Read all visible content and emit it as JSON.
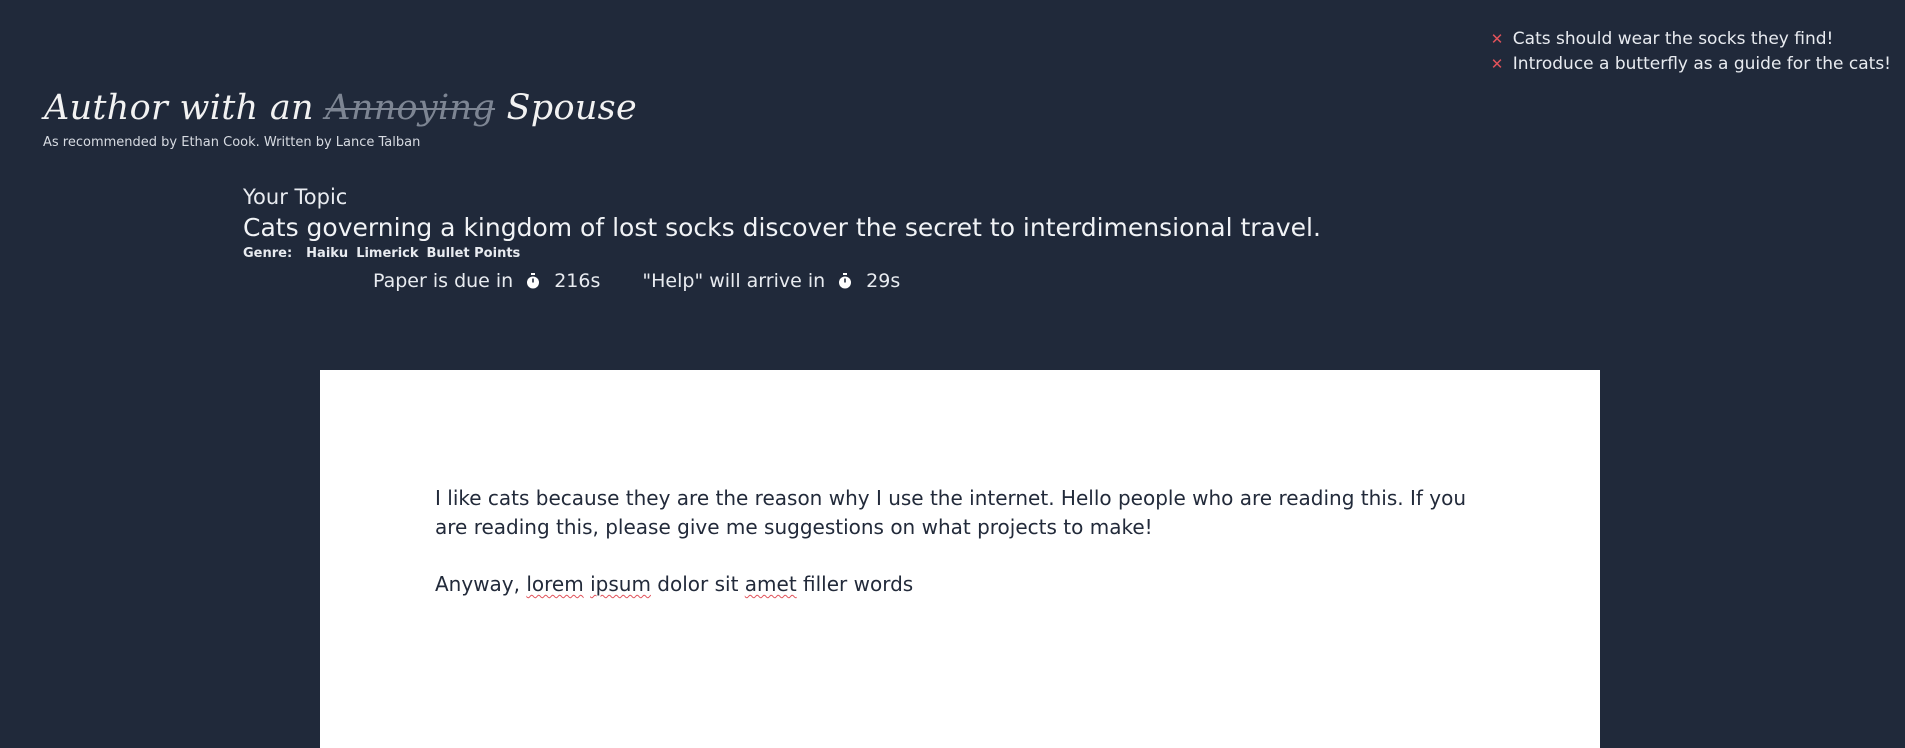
{
  "notifications": [
    {
      "text": "Cats should wear the socks they find!"
    },
    {
      "text": "Introduce a butterfly as a guide for the cats!"
    }
  ],
  "header": {
    "title_start": "Author with an",
    "title_strike": "Annoying",
    "title_end": "Spouse",
    "subtitle": "As recommended by Ethan Cook. Written by Lance Talban"
  },
  "topic": {
    "label": "Your Topic",
    "text": "Cats governing a kingdom of lost socks discover the secret to interdimensional travel.",
    "genre_label": "Genre:",
    "genres": [
      "Haiku",
      "Limerick",
      "Bullet Points"
    ]
  },
  "timers": {
    "paper_label": "Paper is due in",
    "paper_value": "216s",
    "help_label": "\"Help\" will arrive in",
    "help_value": "29s",
    "icon": "stopwatch-icon"
  },
  "paper": {
    "para1": "I like cats because they are the reason why I use the internet. Hello people who are reading this. If you are reading this, please give me suggestions on what projects to make!",
    "para2_a": "Anyway, ",
    "para2_b": "lorem",
    "para2_c": " ",
    "para2_d": "ipsum",
    "para2_e": " dolor sit ",
    "para2_f": "amet",
    "para2_g": " filler words"
  },
  "colors": {
    "background": "#20293a",
    "paper": "#ffffff",
    "error": "#e0525a"
  }
}
